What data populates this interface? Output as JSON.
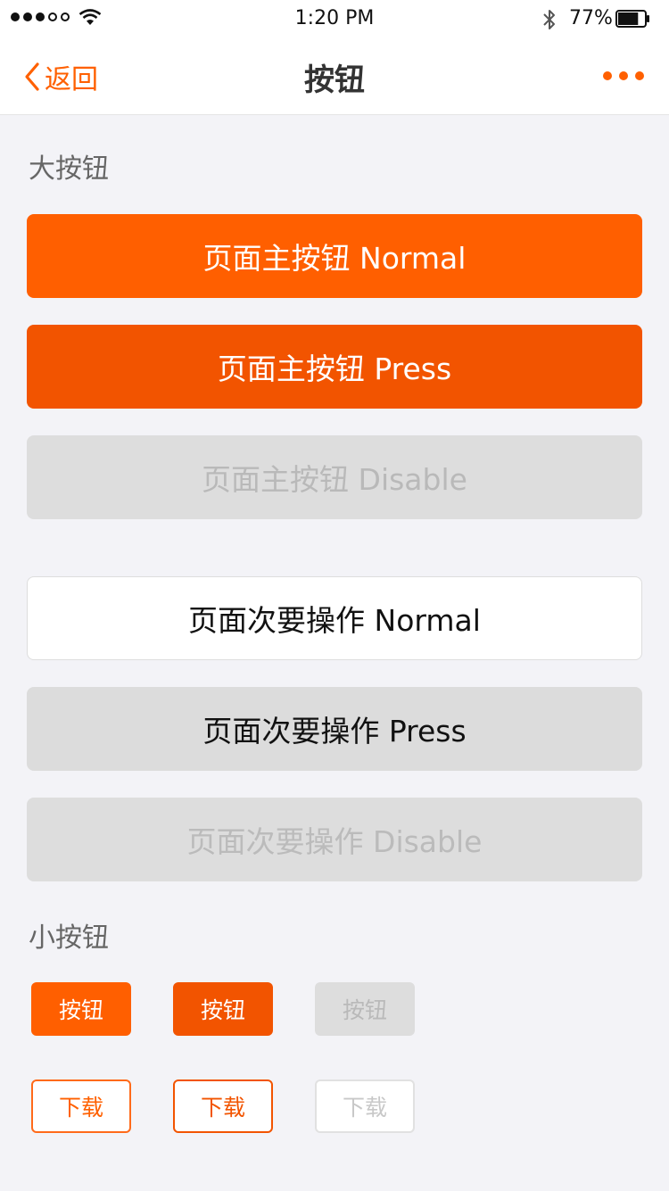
{
  "status_bar": {
    "time": "1:20 PM",
    "battery_percent": "77%",
    "battery_level": 0.77,
    "signal_bars_filled": 3,
    "signal_bars_total": 5
  },
  "nav": {
    "back_label": "返回",
    "title": "按钮",
    "accent_color": "#ff6000"
  },
  "sections": {
    "large_title": "大按钮",
    "small_title": "小按钮"
  },
  "large_buttons": {
    "primary_normal": "页面主按钮 Normal",
    "primary_press": "页面主按钮 Press",
    "primary_disable": "页面主按钮 Disable",
    "secondary_normal": "页面次要操作 Normal",
    "secondary_press": "页面次要操作 Press",
    "secondary_disable": "页面次要操作 Disable"
  },
  "small_buttons": {
    "primary_label": "按钮",
    "outline_label": "下载"
  },
  "colors": {
    "primary": "#ff5f00",
    "primary_pressed": "#f25400",
    "disabled_bg": "#dddddd",
    "page_bg": "#f3f3f7"
  }
}
